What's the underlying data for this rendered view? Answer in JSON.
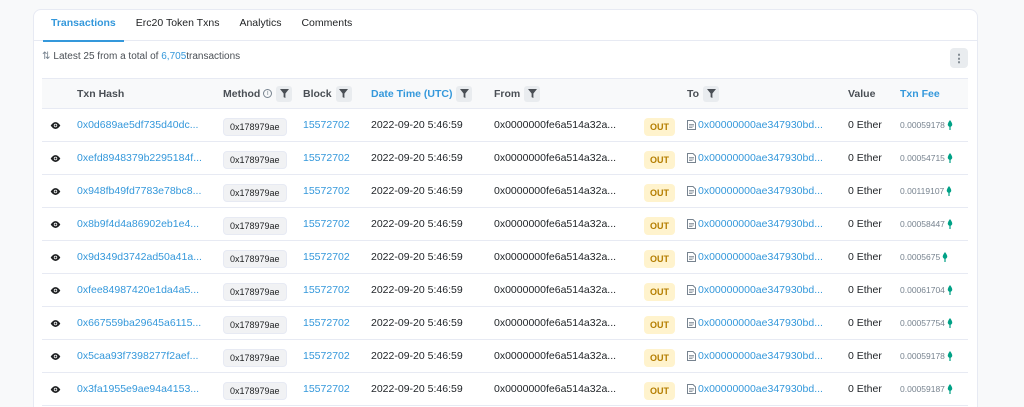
{
  "tabs": [
    {
      "label": "Transactions",
      "active": true
    },
    {
      "label": "Erc20 Token Txns",
      "active": false
    },
    {
      "label": "Analytics",
      "active": false
    },
    {
      "label": "Comments",
      "active": false
    }
  ],
  "summary": {
    "prefix": "Latest 25 from a total of ",
    "count": "6,705",
    "suffix": " transactions"
  },
  "columns": {
    "txn_hash": "Txn Hash",
    "method": "Method",
    "block": "Block",
    "datetime": "Date Time (UTC)",
    "from": "From",
    "to": "To",
    "value": "Value",
    "fee": "Txn Fee"
  },
  "rows": [
    {
      "hash": "0x0d689ae5df735d40dc...",
      "method": "0x178979ae",
      "block": "15572702",
      "time": "2022-09-20 5:46:59",
      "from": "0x0000000fe6a514a32a...",
      "direction": "OUT",
      "to": "0x00000000ae347930bd...",
      "value": "0 Ether",
      "fee": "0.00059178"
    },
    {
      "hash": "0xefd8948379b2295184f...",
      "method": "0x178979ae",
      "block": "15572702",
      "time": "2022-09-20 5:46:59",
      "from": "0x0000000fe6a514a32a...",
      "direction": "OUT",
      "to": "0x00000000ae347930bd...",
      "value": "0 Ether",
      "fee": "0.00054715"
    },
    {
      "hash": "0x948fb49fd7783e78bc8...",
      "method": "0x178979ae",
      "block": "15572702",
      "time": "2022-09-20 5:46:59",
      "from": "0x0000000fe6a514a32a...",
      "direction": "OUT",
      "to": "0x00000000ae347930bd...",
      "value": "0 Ether",
      "fee": "0.00119107"
    },
    {
      "hash": "0x8b9f4d4a86902eb1e4...",
      "method": "0x178979ae",
      "block": "15572702",
      "time": "2022-09-20 5:46:59",
      "from": "0x0000000fe6a514a32a...",
      "direction": "OUT",
      "to": "0x00000000ae347930bd...",
      "value": "0 Ether",
      "fee": "0.00058447"
    },
    {
      "hash": "0x9d349d3742ad50a41a...",
      "method": "0x178979ae",
      "block": "15572702",
      "time": "2022-09-20 5:46:59",
      "from": "0x0000000fe6a514a32a...",
      "direction": "OUT",
      "to": "0x00000000ae347930bd...",
      "value": "0 Ether",
      "fee": "0.0005675"
    },
    {
      "hash": "0xfee84987420e1da4a5...",
      "method": "0x178979ae",
      "block": "15572702",
      "time": "2022-09-20 5:46:59",
      "from": "0x0000000fe6a514a32a...",
      "direction": "OUT",
      "to": "0x00000000ae347930bd...",
      "value": "0 Ether",
      "fee": "0.00061704"
    },
    {
      "hash": "0x667559ba29645a6115...",
      "method": "0x178979ae",
      "block": "15572702",
      "time": "2022-09-20 5:46:59",
      "from": "0x0000000fe6a514a32a...",
      "direction": "OUT",
      "to": "0x00000000ae347930bd...",
      "value": "0 Ether",
      "fee": "0.00057754"
    },
    {
      "hash": "0x5caa93f7398277f2aef...",
      "method": "0x178979ae",
      "block": "15572702",
      "time": "2022-09-20 5:46:59",
      "from": "0x0000000fe6a514a32a...",
      "direction": "OUT",
      "to": "0x00000000ae347930bd...",
      "value": "0 Ether",
      "fee": "0.00059178"
    },
    {
      "hash": "0x3fa1955e9ae94a4153...",
      "method": "0x178979ae",
      "block": "15572702",
      "time": "2022-09-20 5:46:59",
      "from": "0x0000000fe6a514a32a...",
      "direction": "OUT",
      "to": "0x00000000ae347930bd...",
      "value": "0 Ether",
      "fee": "0.00059187"
    }
  ],
  "colors": {
    "accent": "#3498db",
    "out_badge_bg": "#fff3cd",
    "out_badge_text": "#b47d00",
    "gas_icon": "#00a186"
  },
  "icons": {
    "summary": "sort-icon",
    "kebab": "more-vertical-icon",
    "filter": "filter-icon",
    "info": "info-icon",
    "eye": "eye-icon",
    "contract": "contract-doc-icon",
    "gas": "gas-icon"
  }
}
